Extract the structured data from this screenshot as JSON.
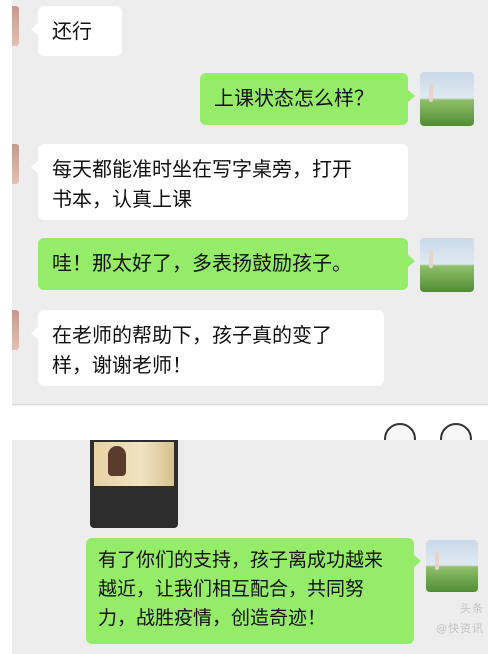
{
  "messages_top": [
    {
      "side": "left",
      "text": "还行"
    },
    {
      "side": "right",
      "text": "上课状态怎么样？"
    },
    {
      "side": "left",
      "line1": "每天都能准时坐在写字桌旁，打开",
      "line2": "书本，认真上课"
    },
    {
      "side": "right",
      "text": "哇！那太好了，多表扬鼓励孩子。"
    },
    {
      "side": "left",
      "line1": "在老师的帮助下，孩子真的变了",
      "line2": "样，谢谢老师！"
    }
  ],
  "messages_bottom": [
    {
      "side": "right",
      "line1": "有了你们的支持，孩子离成功越来",
      "line2": "越近，让我们相互配合，共同努",
      "line3": "力，战胜疫情，创造奇迹！"
    }
  ],
  "watermark": {
    "brand": "头条",
    "source": "@快资讯"
  },
  "colors": {
    "background": "#ededed",
    "sent_bubble": "#95ec69",
    "received_bubble": "#ffffff"
  }
}
